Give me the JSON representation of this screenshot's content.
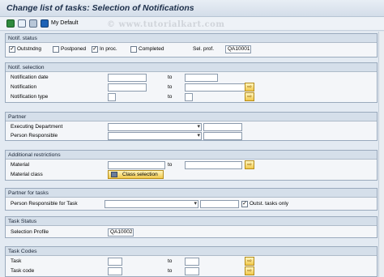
{
  "window": {
    "title": "Change list of tasks: Selection of Notifications"
  },
  "toolbar": {
    "my_default": "My Default",
    "watermark": "© www.tutorialkart.com"
  },
  "notif_status": {
    "heading": "Notif. status",
    "outstanding": "Outstndng",
    "postponed": "Postponed",
    "in_proc": "In proc.",
    "completed": "Completed",
    "sel_prof_label": "Sel. prof.",
    "sel_prof_value": "QA10001"
  },
  "notif_selection": {
    "heading": "Notif. selection",
    "rows": [
      {
        "label": "Notification date",
        "to": "to"
      },
      {
        "label": "Notification",
        "to": "to"
      },
      {
        "label": "Notification type",
        "to": "to"
      }
    ]
  },
  "partner": {
    "heading": "Partner",
    "executing_department": "Executing Department",
    "person_responsible": "Person Responsible"
  },
  "additional": {
    "heading": "Additional restrictions",
    "material": "Material",
    "to": "to",
    "material_class": "Material class",
    "class_selection": "Class selection"
  },
  "partner_tasks": {
    "heading": "Partner for tasks",
    "person_responsible_task": "Person Responsible for Task",
    "outst_tasks_only": "Outst. tasks only"
  },
  "task_status": {
    "heading": "Task Status",
    "selection_profile": "Selection Profile",
    "selection_profile_value": "QA10002"
  },
  "task_codes": {
    "heading": "Task Codes",
    "task": "Task",
    "task_code": "Task code",
    "to": "to"
  }
}
